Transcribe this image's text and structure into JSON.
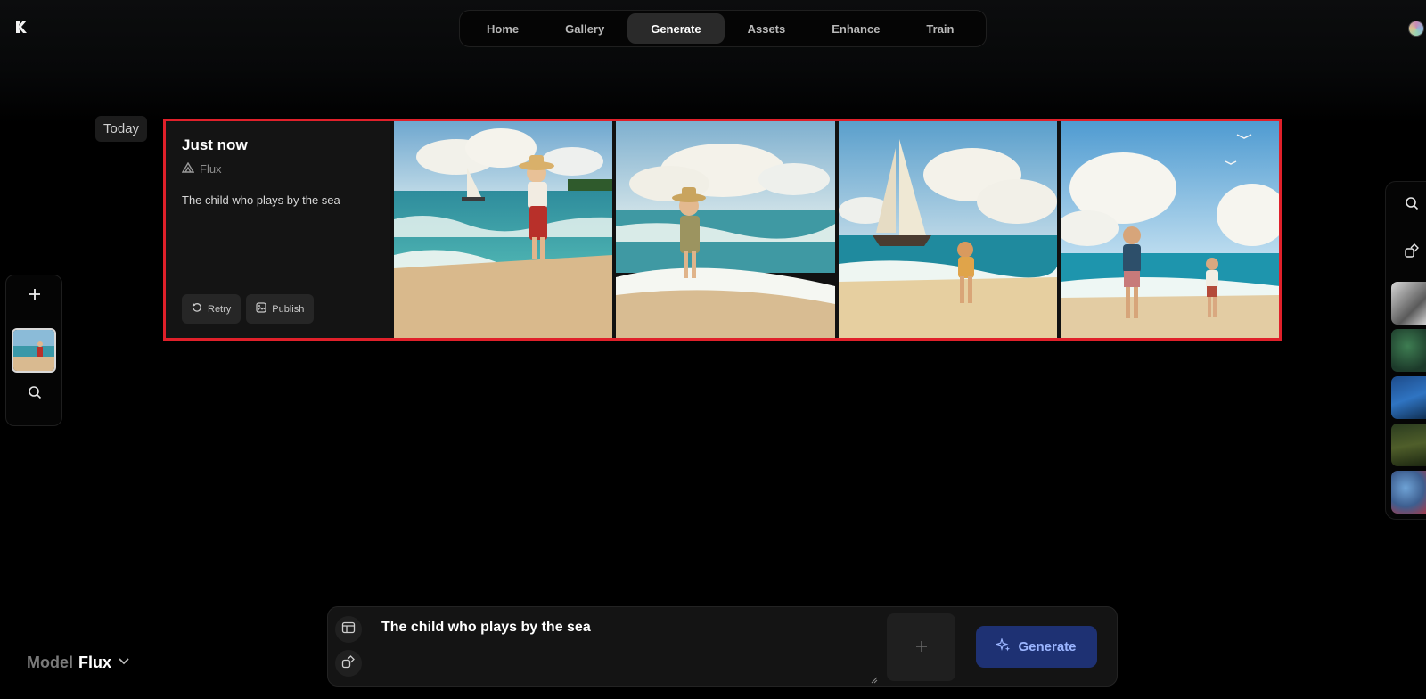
{
  "nav": {
    "tabs": [
      {
        "label": "Home"
      },
      {
        "label": "Gallery"
      },
      {
        "label": "Generate",
        "active": true
      },
      {
        "label": "Assets"
      },
      {
        "label": "Enhance"
      },
      {
        "label": "Train"
      }
    ]
  },
  "feed": {
    "date_label": "Today",
    "generation": {
      "time_label": "Just now",
      "model": "Flux",
      "prompt": "The child who plays by the sea",
      "retry_label": "Retry",
      "publish_label": "Publish",
      "image_count": 4
    }
  },
  "model_selector": {
    "label": "Model",
    "value": "Flux"
  },
  "prompt_bar": {
    "value": "The child who plays by the sea",
    "generate_label": "Generate"
  },
  "colors": {
    "accent": "#1e3173",
    "accent_text": "#9bb5ff",
    "highlight": "#e0202a",
    "background": "#000000"
  },
  "icons": {
    "logo": "logo-icon",
    "add": "plus-icon",
    "search": "search-icon",
    "image_prompt": "image-prompt-icon",
    "style": "style-icon",
    "retry": "retry-icon",
    "publish": "publish-icon",
    "model": "model-icon",
    "chevron": "chevron-down-icon",
    "sparkle": "sparkle-icon"
  }
}
